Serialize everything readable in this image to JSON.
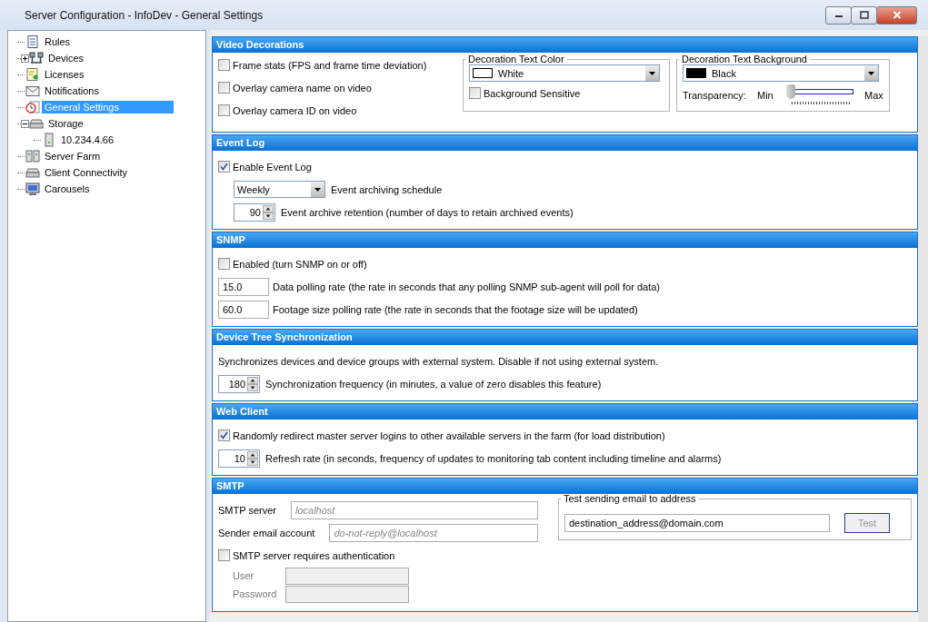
{
  "window": {
    "title": "Server Configuration - InfoDev - General Settings"
  },
  "tree": [
    {
      "label": "Rules",
      "kind": "document",
      "selected": false
    },
    {
      "label": "Devices",
      "kind": "network",
      "expanded": false,
      "selected": false
    },
    {
      "label": "Licenses",
      "kind": "certificate",
      "selected": false
    },
    {
      "label": "Notifications",
      "kind": "envelope",
      "selected": false
    },
    {
      "label": "General Settings",
      "kind": "clock",
      "selected": true
    },
    {
      "label": "Storage",
      "kind": "drive",
      "expanded": true,
      "selected": false,
      "children": [
        {
          "label": "10.234.4.66",
          "kind": "server",
          "selected": false
        }
      ]
    },
    {
      "label": "Server Farm",
      "kind": "servers",
      "selected": false
    },
    {
      "label": "Client Connectivity",
      "kind": "drive",
      "selected": false
    },
    {
      "label": "Carousels",
      "kind": "monitor",
      "selected": false
    }
  ],
  "sections": [
    {
      "title": "Video Decorations",
      "kind": "video",
      "checkboxes": [
        {
          "label": "Frame stats (FPS and frame time deviation)",
          "checked": false
        },
        {
          "label": "Overlay camera name on video",
          "checked": false
        },
        {
          "label": "Overlay camera ID on video",
          "checked": false
        }
      ],
      "text_color": {
        "title": "Decoration Text Color",
        "value": "White",
        "color": "#ffffff",
        "option": {
          "label": "Background Sensitive",
          "checked": false
        }
      },
      "text_background": {
        "title": "Decoration Text Background",
        "value": "Black",
        "color": "#000000",
        "slider_label": "Transparency:",
        "min": "Min",
        "max": "Max",
        "level": 0
      }
    },
    {
      "title": "Event Log",
      "kind": "rows",
      "rows": [
        {
          "kind": "checkbox",
          "label": "Enable Event Log",
          "checked": true,
          "children": [
            {
              "kind": "dropdown",
              "value": "Weekly",
              "description": "Event archiving schedule"
            },
            {
              "kind": "spinner",
              "value": "90",
              "description": "Event archive retention (number of days to retain archived events)"
            }
          ]
        }
      ]
    },
    {
      "title": "SNMP",
      "kind": "rows",
      "rows": [
        {
          "kind": "checkbox",
          "label": "Enabled (turn SNMP on or off)",
          "checked": false
        },
        {
          "kind": "textfield",
          "value": "15.0",
          "description": "Data polling rate (the rate in seconds that any polling SNMP sub-agent will poll for data)"
        },
        {
          "kind": "textfield",
          "value": "60.0",
          "description": "Footage size polling rate (the rate in seconds that the footage size will be updated)"
        }
      ]
    },
    {
      "title": "Device Tree Synchronization",
      "kind": "rows",
      "rows": [
        {
          "kind": "text",
          "text": "Synchronizes devices and device groups with external system. Disable if not using external system."
        },
        {
          "kind": "spinner",
          "value": "180",
          "description": "Synchronization frequency (in minutes, a value of zero disables this feature)"
        }
      ]
    },
    {
      "title": "Web Client",
      "kind": "rows",
      "rows": [
        {
          "kind": "checkbox",
          "label": "Randomly redirect master server logins to other available servers in the farm (for load distribution)",
          "checked": true
        },
        {
          "kind": "spinner",
          "value": "10",
          "description": "Refresh rate (in seconds, frequency of updates to monitoring tab content including timeline and alarms)"
        }
      ]
    },
    {
      "title": "SMTP",
      "kind": "smtp",
      "fields": [
        {
          "label": "SMTP server",
          "placeholder": "localhost"
        },
        {
          "label": "Sender email account",
          "placeholder": "do-not-reply@localhost"
        }
      ],
      "auth": {
        "label": "SMTP server requires authentication",
        "checked": false
      },
      "credentials": [
        {
          "label": "User",
          "disabled": true
        },
        {
          "label": "Password",
          "disabled": true
        }
      ],
      "test": {
        "title": "Test sending email to address",
        "value": "destination_address@domain.com",
        "button": "Test",
        "button_disabled": true
      }
    }
  ]
}
